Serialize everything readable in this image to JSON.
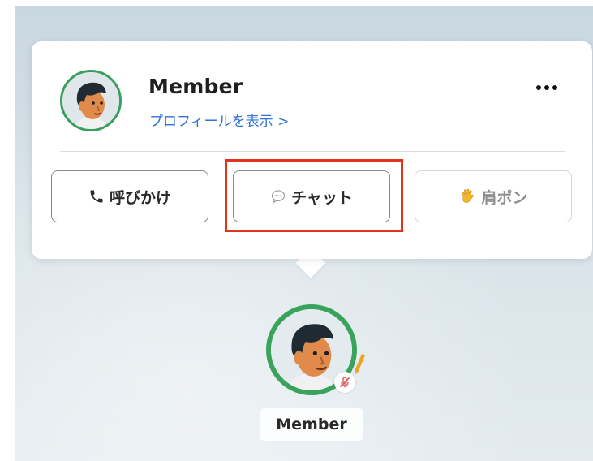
{
  "popup": {
    "member_name": "Member",
    "profile_link": "プロフィールを表示 >",
    "more_icon": "more-dots-icon",
    "actions": {
      "call": {
        "label": "呼びかけ",
        "icon": "phone-icon"
      },
      "chat": {
        "label": "チャット",
        "icon": "chat-bubble-icon"
      },
      "tap_shoulder": {
        "label": "肩ポン",
        "icon": "waving-hand-icon"
      }
    }
  },
  "avatar": {
    "name_tag": "Member",
    "ring_color": "#39a35c",
    "status_icon": "mic-muted-icon"
  },
  "highlight_color": "#e2311f",
  "link_color": "#2f72d8"
}
